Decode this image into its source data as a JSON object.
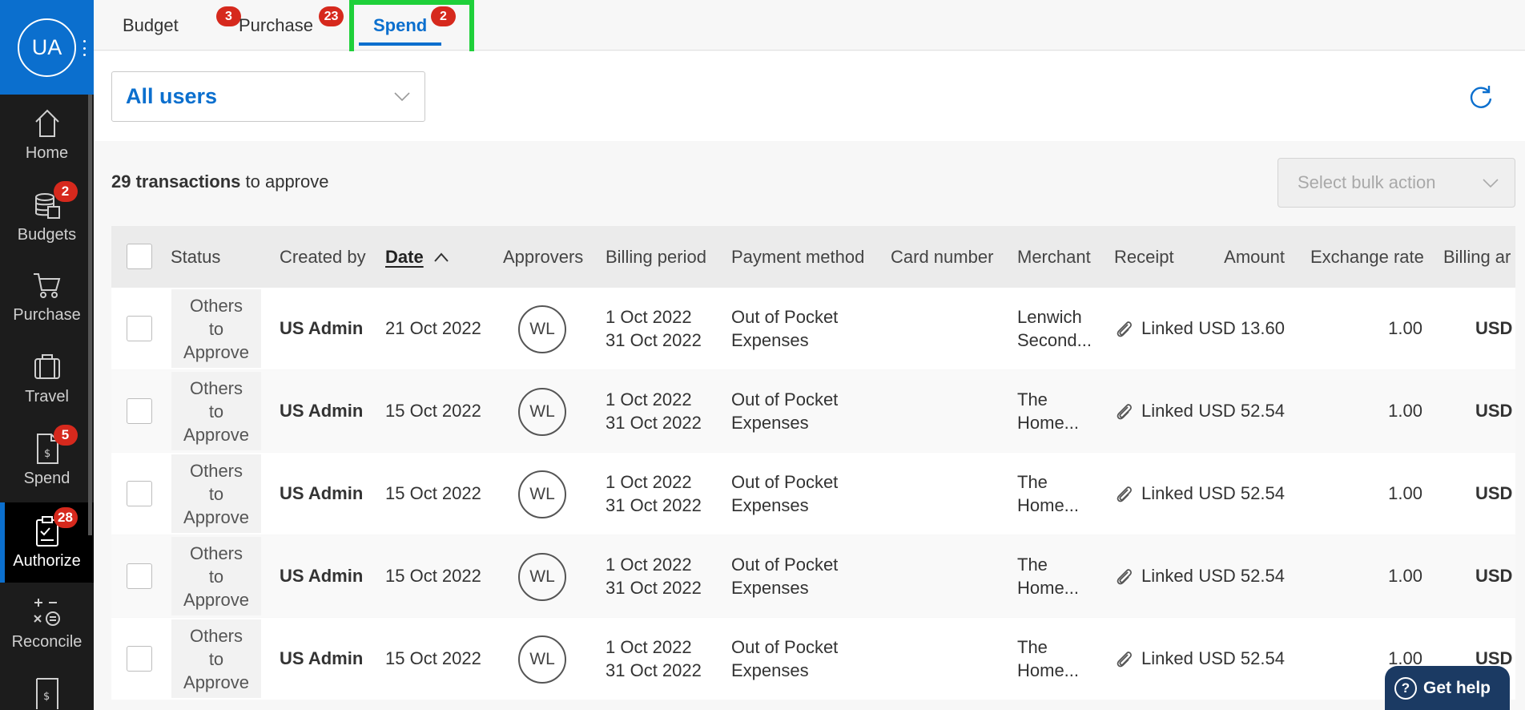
{
  "user": {
    "initials": "UA"
  },
  "sidebar": {
    "items": [
      {
        "label": "Home",
        "icon": "home-icon",
        "badge": null
      },
      {
        "label": "Budgets",
        "icon": "budgets-icon",
        "badge": "2"
      },
      {
        "label": "Purchase",
        "icon": "cart-icon",
        "badge": null
      },
      {
        "label": "Travel",
        "icon": "suitcase-icon",
        "badge": null
      },
      {
        "label": "Spend",
        "icon": "spend-receipt-icon",
        "badge": "5"
      },
      {
        "label": "Authorize",
        "icon": "clipboard-check-icon",
        "badge": "28"
      },
      {
        "label": "Reconcile",
        "icon": "calculator-icon",
        "badge": null
      }
    ]
  },
  "tabs": [
    {
      "label": "Budget",
      "badge": "3"
    },
    {
      "label": "Purchase",
      "badge": "23"
    },
    {
      "label": "Spend",
      "badge": "2"
    }
  ],
  "filter": {
    "users_value": "All users"
  },
  "summary": {
    "count_text": "29 transactions",
    "suffix": " to approve"
  },
  "bulk_action": {
    "placeholder": "Select bulk action"
  },
  "table": {
    "headers": {
      "status": "Status",
      "created_by": "Created by",
      "date": "Date",
      "approvers": "Approvers",
      "billing_period": "Billing period",
      "payment_method": "Payment method",
      "card_number": "Card number",
      "merchant": "Merchant",
      "receipt": "Receipt",
      "amount": "Amount",
      "exchange_rate": "Exchange rate",
      "billing_amount": "Billing ar"
    },
    "rows": [
      {
        "status": [
          "Others",
          "to",
          "Approve"
        ],
        "created_by": "US Admin",
        "date": "21 Oct 2022",
        "approver": "WL",
        "period_start": "1 Oct 2022",
        "period_end": "31 Oct 2022",
        "payment_1": "Out of Pocket",
        "payment_2": "Expenses",
        "merchant_1": "Lenwich",
        "merchant_2": "Second...",
        "receipt": "Linked",
        "amount": "USD 13.60",
        "exchange_rate": "1.00",
        "billing": "USD"
      },
      {
        "status": [
          "Others",
          "to",
          "Approve"
        ],
        "created_by": "US Admin",
        "date": "15 Oct 2022",
        "approver": "WL",
        "period_start": "1 Oct 2022",
        "period_end": "31 Oct 2022",
        "payment_1": "Out of Pocket",
        "payment_2": "Expenses",
        "merchant_1": "The",
        "merchant_2": "Home...",
        "receipt": "Linked",
        "amount": "USD 52.54",
        "exchange_rate": "1.00",
        "billing": "USD"
      },
      {
        "status": [
          "Others",
          "to",
          "Approve"
        ],
        "created_by": "US Admin",
        "date": "15 Oct 2022",
        "approver": "WL",
        "period_start": "1 Oct 2022",
        "period_end": "31 Oct 2022",
        "payment_1": "Out of Pocket",
        "payment_2": "Expenses",
        "merchant_1": "The",
        "merchant_2": "Home...",
        "receipt": "Linked",
        "amount": "USD 52.54",
        "exchange_rate": "1.00",
        "billing": "USD"
      },
      {
        "status": [
          "Others",
          "to",
          "Approve"
        ],
        "created_by": "US Admin",
        "date": "15 Oct 2022",
        "approver": "WL",
        "period_start": "1 Oct 2022",
        "period_end": "31 Oct 2022",
        "payment_1": "Out of Pocket",
        "payment_2": "Expenses",
        "merchant_1": "The",
        "merchant_2": "Home...",
        "receipt": "Linked",
        "amount": "USD 52.54",
        "exchange_rate": "1.00",
        "billing": "USD"
      },
      {
        "status": [
          "Others",
          "to",
          "Approve"
        ],
        "created_by": "US Admin",
        "date": "15 Oct 2022",
        "approver": "WL",
        "period_start": "1 Oct 2022",
        "period_end": "31 Oct 2022",
        "payment_1": "Out of Pocket",
        "payment_2": "Expenses",
        "merchant_1": "The",
        "merchant_2": "Home...",
        "receipt": "Linked",
        "amount": "USD 52.54",
        "exchange_rate": "1.00",
        "billing": "USD"
      }
    ]
  },
  "help": {
    "label": "Get help"
  },
  "colors": {
    "brand": "#0b6fce",
    "badge": "#d6291d",
    "highlight": "#1fd03a",
    "help": "#1b3a63"
  }
}
